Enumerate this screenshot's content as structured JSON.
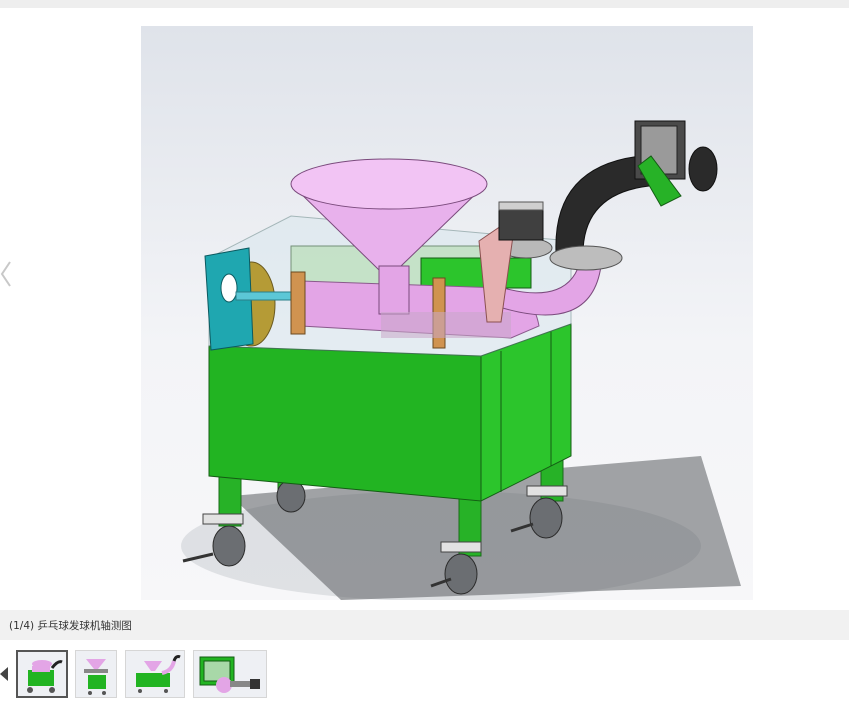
{
  "viewer": {
    "caption": "(1/4) 乒乓球发球机轴测图",
    "prev_icon": "chevron-left-icon",
    "image_subject": "ping-pong-serving-machine-render"
  },
  "thumbnails": {
    "prev_icon": "triangle-left-icon",
    "items": [
      {
        "name": "thumb-1",
        "active": true
      },
      {
        "name": "thumb-2",
        "active": false
      },
      {
        "name": "thumb-3",
        "active": false
      },
      {
        "name": "thumb-4",
        "active": false
      }
    ]
  },
  "colors": {
    "body_green": "#22b422",
    "hopper_pink": "#e6a8e8",
    "caption_bg": "#f1f1f1",
    "accent_teal": "#1fa7b0"
  }
}
